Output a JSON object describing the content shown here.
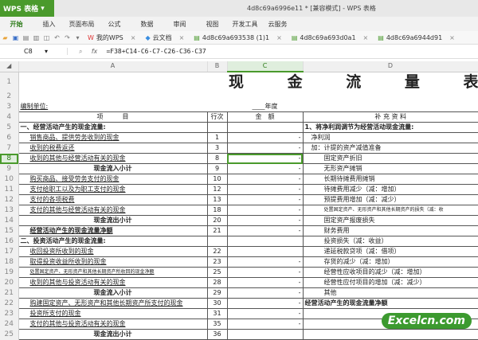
{
  "app": {
    "name": "WPS 表格",
    "window_title": "4d8c69a6996e11 * [兼容模式] - WPS 表格"
  },
  "menu": [
    "开始",
    "插入",
    "页面布局",
    "公式",
    "数据",
    "审阅",
    "视图",
    "开发工具",
    "云服务"
  ],
  "tabs": [
    {
      "label": "我的WPS"
    },
    {
      "label": "云文档"
    },
    {
      "label": "4d8c69a693538 (1)1"
    },
    {
      "label": "4d8c69a693d0a1"
    },
    {
      "label": "4d8c69a6944d91"
    }
  ],
  "formula_bar": {
    "cell": "C8",
    "fx": "fx",
    "formula": "=F38+C14-C6-C7-C26-C36-C37"
  },
  "columns": [
    "A",
    "B",
    "C",
    "D"
  ],
  "sheet": {
    "title": "现 金 流 量 表",
    "unit_label": "编制单位:",
    "year_label": "____年度",
    "headers": {
      "item": "项　　　目",
      "line": "行次",
      "amount": "金　额",
      "supplement": "补 充 资 料"
    },
    "rows": [
      {
        "n": 5,
        "a": "一、经营活动产生的现金流量:",
        "b": "",
        "c": "",
        "d": "1、将净利润调节为经营活动现金流量:",
        "as": "bold",
        "ds": "bold"
      },
      {
        "n": 6,
        "a": "销售商品、提供劳务收到的现金",
        "b": "1",
        "c": "-",
        "d": "净利润",
        "as": "ind",
        "ds": "d1"
      },
      {
        "n": 7,
        "a": "收到的税费返还",
        "b": "3",
        "c": "-",
        "d": "加：计提的资产减值准备",
        "as": "ind",
        "ds": "d1"
      },
      {
        "n": 8,
        "a": "收到的其他与经营活动有关的现金",
        "b": "8",
        "c": "-",
        "d": "固定资产折旧",
        "as": "ind",
        "ds": "d2"
      },
      {
        "n": 9,
        "a": "现金流入小计",
        "b": "9",
        "c": "-",
        "d": "无形资产摊销",
        "as": "sub",
        "ds": "d2"
      },
      {
        "n": 10,
        "a": "购买商品、接受劳务支付的现金",
        "b": "10",
        "c": "-",
        "d": "长期待摊费用摊销",
        "as": "ind",
        "ds": "d2"
      },
      {
        "n": 11,
        "a": "支付给职工以及为职工支付的现金",
        "b": "12",
        "c": "-",
        "d": "待摊费用减少（减：增加）",
        "as": "ind",
        "ds": "d2"
      },
      {
        "n": 12,
        "a": "支付的各项税费",
        "b": "13",
        "c": "-",
        "d": "预提费用增加（减：减少）",
        "as": "ind",
        "ds": "d2"
      },
      {
        "n": 13,
        "a": "支付的其他与经营活动有关的现金",
        "b": "18",
        "c": "-",
        "d": "处置固定资产、无形资产和其他长期资产的损失（减：收",
        "as": "ind",
        "ds": "d2s"
      },
      {
        "n": 14,
        "a": "现金流出小计",
        "b": "20",
        "c": "-",
        "d": "固定资产报废损失",
        "as": "sub",
        "ds": "d2"
      },
      {
        "n": 15,
        "a": "经营活动产生的现金流量净额",
        "b": "21",
        "c": "-",
        "d": "财务费用",
        "as": "indb",
        "ds": "d2"
      },
      {
        "n": 16,
        "a": "二、投资活动产生的现金流量:",
        "b": "",
        "c": "",
        "d": "投资损失（减：收益）",
        "as": "bold",
        "ds": "d2"
      },
      {
        "n": 17,
        "a": "收回投资所收到的现金",
        "b": "22",
        "c": "",
        "d": "递延税款贷项（减：借项）",
        "as": "ind",
        "ds": "d2"
      },
      {
        "n": 18,
        "a": "取得投资收益所收到的现金",
        "b": "23",
        "c": "-",
        "d": "存货的减少（减：增加）",
        "as": "ind",
        "ds": "d2"
      },
      {
        "n": 19,
        "a": "处置固定资产、无形资产和其他长期资产所收回的现金净额",
        "b": "25",
        "c": "-",
        "d": "经营性应收项目的减少（减：增加）",
        "as": "inds",
        "ds": "d2"
      },
      {
        "n": 20,
        "a": "收到的其他与投资活动有关的现金",
        "b": "28",
        "c": "-",
        "d": "经营性应付项目的增加（减：减少）",
        "as": "ind",
        "ds": "d2"
      },
      {
        "n": 21,
        "a": "现金流入小计",
        "b": "29",
        "c": "-",
        "d": "其他",
        "as": "sub",
        "ds": "d2"
      },
      {
        "n": 22,
        "a": "购建固定资产、无形资产和其他长期资产所支付的现金",
        "b": "30",
        "c": "-",
        "d": "经营活动产生的现金流量净额",
        "as": "ind",
        "ds": "bold"
      },
      {
        "n": 23,
        "a": "投资所支付的现金",
        "b": "31",
        "c": "-",
        "d": "",
        "as": "ind",
        "ds": ""
      },
      {
        "n": 24,
        "a": "支付的其他与投资活动有关的现金",
        "b": "35",
        "c": "-",
        "d": "",
        "as": "ind",
        "ds": ""
      },
      {
        "n": 25,
        "a": "现金流出小计",
        "b": "36",
        "c": "",
        "d": "",
        "as": "sub",
        "ds": ""
      }
    ]
  },
  "watermark": "Excelcn.com",
  "colors": {
    "brand": "#4a9a2c"
  }
}
